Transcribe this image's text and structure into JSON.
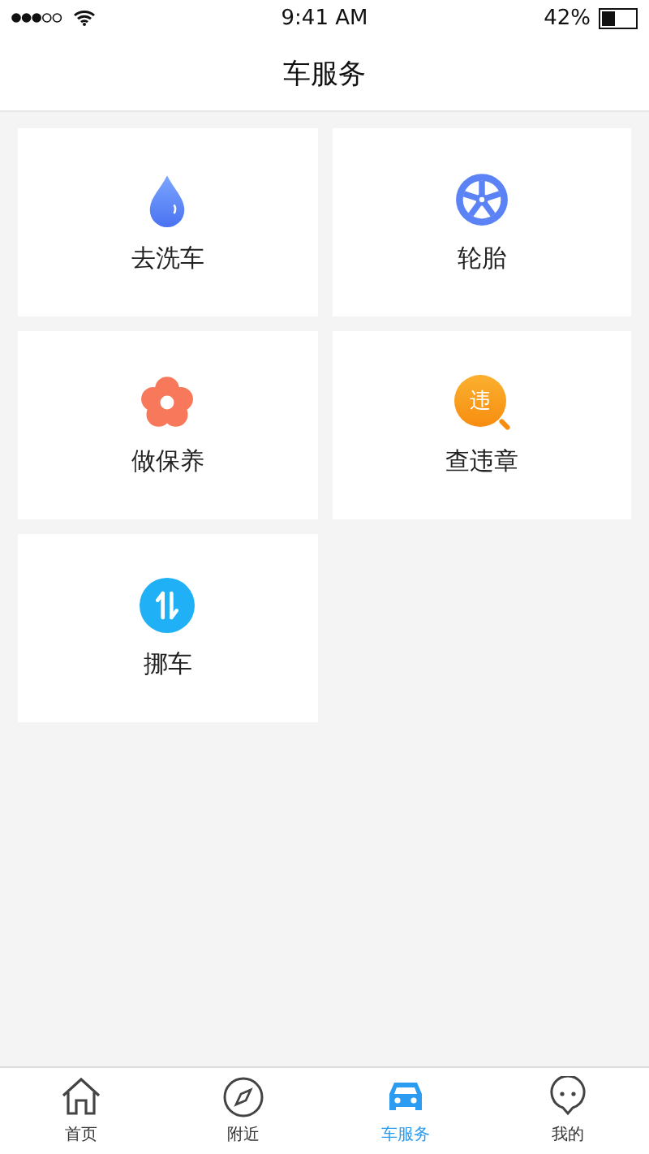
{
  "status_bar": {
    "time": "9:41 AM",
    "battery": "42%"
  },
  "nav": {
    "title": "车服务"
  },
  "service_rows": [
    [
      {
        "kind": "drop",
        "label": "去洗车"
      },
      {
        "kind": "wheel",
        "label": "轮胎"
      }
    ],
    [
      {
        "kind": "flower",
        "label": "做保养"
      },
      {
        "kind": "violation",
        "label": "查违章",
        "badge": "违"
      }
    ],
    [
      {
        "kind": "swap",
        "label": "挪车"
      }
    ]
  ],
  "tabs": [
    {
      "kind": "home",
      "label": "首页",
      "selected": false
    },
    {
      "kind": "compass",
      "label": "附近",
      "selected": false
    },
    {
      "kind": "car",
      "label": "车服务",
      "selected": true
    },
    {
      "kind": "face",
      "label": "我的",
      "selected": false
    }
  ]
}
